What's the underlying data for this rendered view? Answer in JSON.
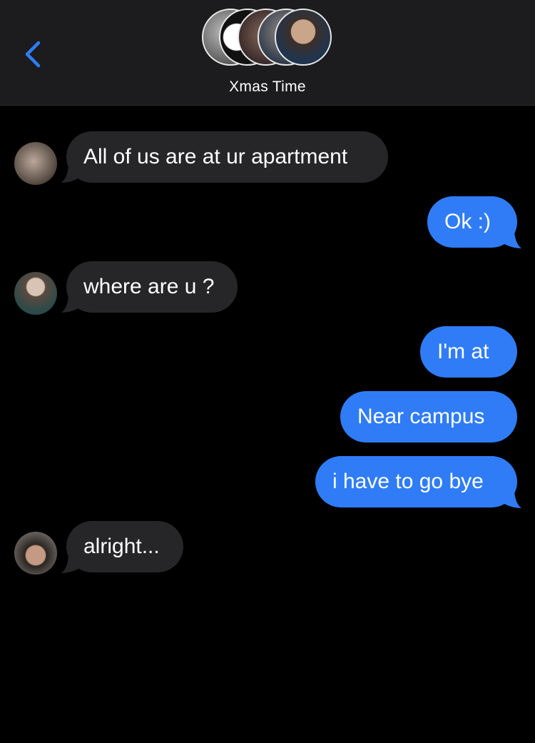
{
  "header": {
    "title": "Xmas Time",
    "back_icon": "chevron-left-icon",
    "colors": {
      "background": "#1c1c1e",
      "accent": "#2f7cf6"
    }
  },
  "messages": [
    {
      "direction": "incoming",
      "text": "All of us are at ur apartment"
    },
    {
      "direction": "outgoing",
      "text": "Ok :)"
    },
    {
      "direction": "incoming",
      "text": "where are u ?"
    },
    {
      "direction": "outgoing",
      "text": "I'm at"
    },
    {
      "direction": "outgoing",
      "text": "Near campus"
    },
    {
      "direction": "outgoing",
      "text": "i have to go bye"
    },
    {
      "direction": "incoming",
      "text": "alright..."
    }
  ],
  "colors": {
    "incoming_bubble": "#262628",
    "outgoing_bubble": "#2f7cf6",
    "text": "#ffffff"
  }
}
